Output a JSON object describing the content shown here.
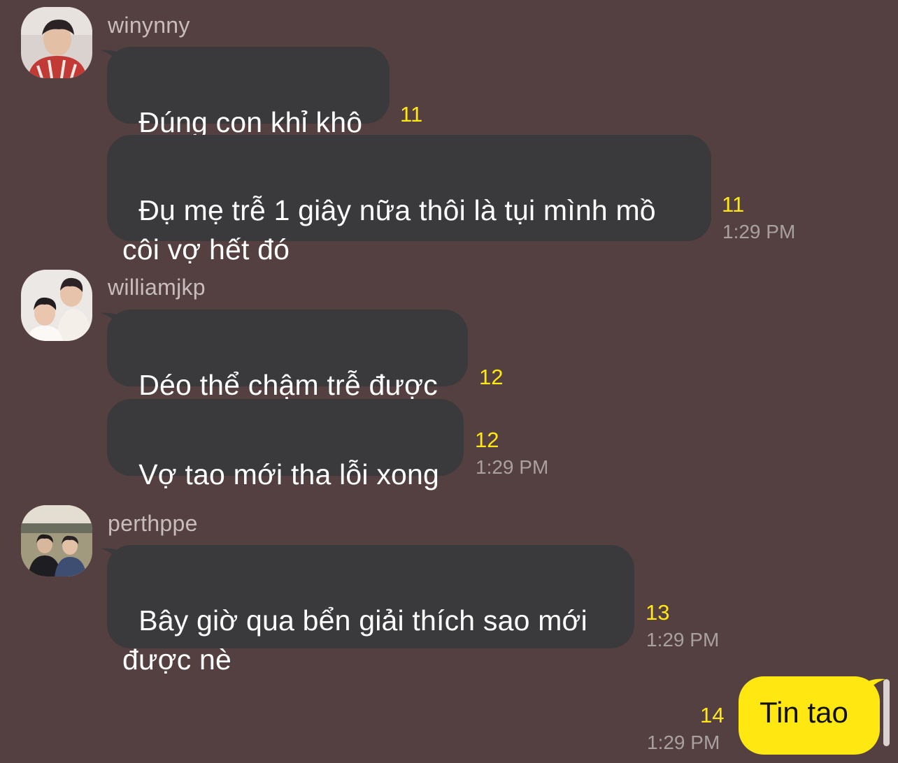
{
  "colors": {
    "background": "#554041",
    "incoming_bubble": "#3a3a3c",
    "outgoing_bubble": "#ffe812",
    "unread_count": "#ffe812"
  },
  "groups": [
    {
      "sender": "winynny",
      "avatar_icon": "profile-photo-icon",
      "messages": [
        {
          "text": "Đúng con khỉ khô",
          "unread": "11",
          "time": ""
        },
        {
          "text": "Đụ mẹ trễ 1 giây nữa thôi là tụi mình mồ\ncôi vợ hết đó",
          "unread": "11",
          "time": "1:29 PM"
        }
      ]
    },
    {
      "sender": "williamjkp",
      "avatar_icon": "profile-photo-icon",
      "messages": [
        {
          "text": "Déo thể chậm trễ được",
          "unread": "12",
          "time": ""
        },
        {
          "text": "Vợ tao mới tha lỗi xong",
          "unread": "12",
          "time": "1:29 PM"
        }
      ]
    },
    {
      "sender": "perthppe",
      "avatar_icon": "profile-photo-icon",
      "messages": [
        {
          "text": "Bây giờ qua bển giải thích sao mới\nđược nè",
          "unread": "13",
          "time": "1:29 PM"
        }
      ]
    }
  ],
  "outgoing": {
    "text": "Tin tao",
    "unread": "14",
    "time": "1:29 PM"
  }
}
